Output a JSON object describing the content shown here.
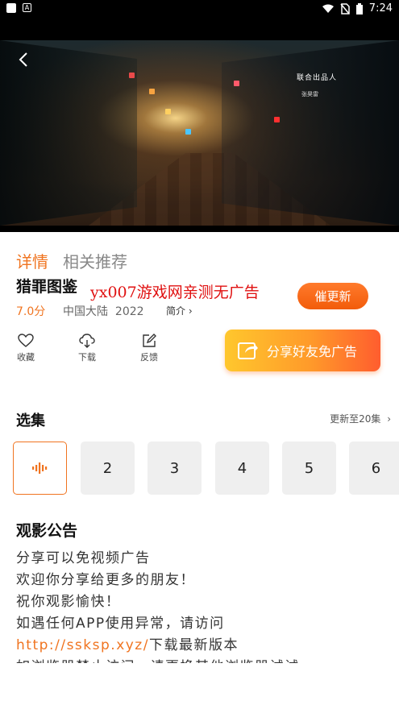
{
  "status_bar": {
    "time": "7:24"
  },
  "video": {
    "credit_line1": "联合出品人",
    "credit_line2": "张昊雷"
  },
  "tabs": [
    "详情",
    "相关推荐"
  ],
  "detail": {
    "title": "猎罪图鉴",
    "rating": "7.0分",
    "region": "中国大陆",
    "year": "2022",
    "intro_label": "简介 ›",
    "urge_button": "催更新"
  },
  "watermark": "yx007游戏网亲测无广告",
  "actions": [
    {
      "label": "收藏",
      "icon": "heart-icon"
    },
    {
      "label": "下载",
      "icon": "download-cloud-icon"
    },
    {
      "label": "反馈",
      "icon": "feedback-edit-icon"
    }
  ],
  "share_button": {
    "label": "分享好友免广告",
    "icon": "share-icon"
  },
  "episodes": {
    "title": "选集",
    "update_text": "更新至20集",
    "update_chevron": "›",
    "items": [
      "2",
      "3",
      "4",
      "5",
      "6"
    ]
  },
  "notice": {
    "title": "观影公告",
    "lines": [
      "分享可以免视频广告",
      "欢迎你分享给更多的朋友！",
      "祝你观影愉快！",
      "如遇任何APP使用异常，请访问"
    ],
    "link": "http://ssksp.xyz/",
    "link_suffix": "下载最新版本",
    "last_line": "如浏览器禁止访问，请更换其他浏览器试试"
  },
  "colors": {
    "accent": "#f07420",
    "watermark": "#e01010"
  }
}
